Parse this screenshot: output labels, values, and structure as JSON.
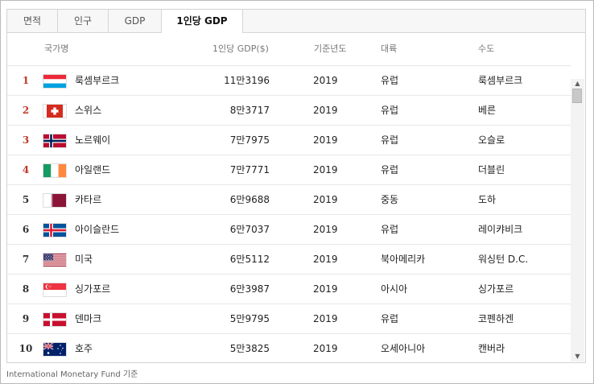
{
  "tabs": [
    {
      "label": "면적",
      "active": false
    },
    {
      "label": "인구",
      "active": false
    },
    {
      "label": "GDP",
      "active": false
    },
    {
      "label": "1인당 GDP",
      "active": true
    }
  ],
  "columns": {
    "country": "국가명",
    "gdp": "1인당 GDP($)",
    "year": "기준년도",
    "continent": "대륙",
    "capital": "수도"
  },
  "rows": [
    {
      "rank": "1",
      "flag_icon": "luxembourg-flag-icon",
      "country": "룩셈부르크",
      "gdp": "11만3196",
      "year": "2019",
      "continent": "유럽",
      "capital": "룩셈부르크"
    },
    {
      "rank": "2",
      "flag_icon": "switzerland-flag-icon",
      "country": "스위스",
      "gdp": "8만3717",
      "year": "2019",
      "continent": "유럽",
      "capital": "베른"
    },
    {
      "rank": "3",
      "flag_icon": "norway-flag-icon",
      "country": "노르웨이",
      "gdp": "7만7975",
      "year": "2019",
      "continent": "유럽",
      "capital": "오슬로"
    },
    {
      "rank": "4",
      "flag_icon": "ireland-flag-icon",
      "country": "아일랜드",
      "gdp": "7만7771",
      "year": "2019",
      "continent": "유럽",
      "capital": "더블린"
    },
    {
      "rank": "5",
      "flag_icon": "qatar-flag-icon",
      "country": "카타르",
      "gdp": "6만9688",
      "year": "2019",
      "continent": "중동",
      "capital": "도하"
    },
    {
      "rank": "6",
      "flag_icon": "iceland-flag-icon",
      "country": "아이슬란드",
      "gdp": "6만7037",
      "year": "2019",
      "continent": "유럽",
      "capital": "레이캬비크"
    },
    {
      "rank": "7",
      "flag_icon": "usa-flag-icon",
      "country": "미국",
      "gdp": "6만5112",
      "year": "2019",
      "continent": "북아메리카",
      "capital": "워싱턴 D.C."
    },
    {
      "rank": "8",
      "flag_icon": "singapore-flag-icon",
      "country": "싱가포르",
      "gdp": "6만3987",
      "year": "2019",
      "continent": "아시아",
      "capital": "싱가포르"
    },
    {
      "rank": "9",
      "flag_icon": "denmark-flag-icon",
      "country": "덴마크",
      "gdp": "5만9795",
      "year": "2019",
      "continent": "유럽",
      "capital": "코펜하겐"
    },
    {
      "rank": "10",
      "flag_icon": "australia-flag-icon",
      "country": "호주",
      "gdp": "5만3825",
      "year": "2019",
      "continent": "오세아니아",
      "capital": "캔버라"
    }
  ],
  "source": "International Monetary Fund 기준",
  "colors": {
    "top_rank": "#c0392b",
    "border": "#d6d6d6"
  }
}
